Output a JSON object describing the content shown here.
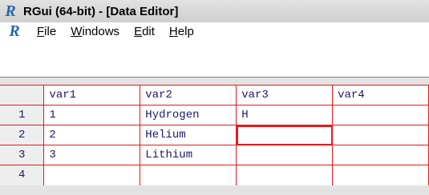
{
  "window": {
    "title": "RGui (64-bit) - [Data Editor]",
    "logo": "R"
  },
  "menu": {
    "logo": "R",
    "items": [
      {
        "accel": "F",
        "rest": "ile"
      },
      {
        "accel": "W",
        "rest": "indows"
      },
      {
        "accel": "E",
        "rest": "dit"
      },
      {
        "accel": "H",
        "rest": "elp"
      }
    ]
  },
  "grid": {
    "columns": [
      "var1",
      "var2",
      "var3",
      "var4"
    ],
    "rows": [
      {
        "num": "1",
        "cells": [
          "1",
          "Hydrogen",
          "H",
          ""
        ]
      },
      {
        "num": "2",
        "cells": [
          "2",
          "Helium",
          "",
          ""
        ]
      },
      {
        "num": "3",
        "cells": [
          "3",
          "Lithium",
          "",
          ""
        ]
      },
      {
        "num": "4",
        "cells": [
          "",
          "",
          "",
          ""
        ]
      }
    ],
    "active_cell": "row 2, var3"
  },
  "colors": {
    "grid_line": "#e8191b",
    "text": "#1a1a66",
    "logo": "#2767b0"
  }
}
